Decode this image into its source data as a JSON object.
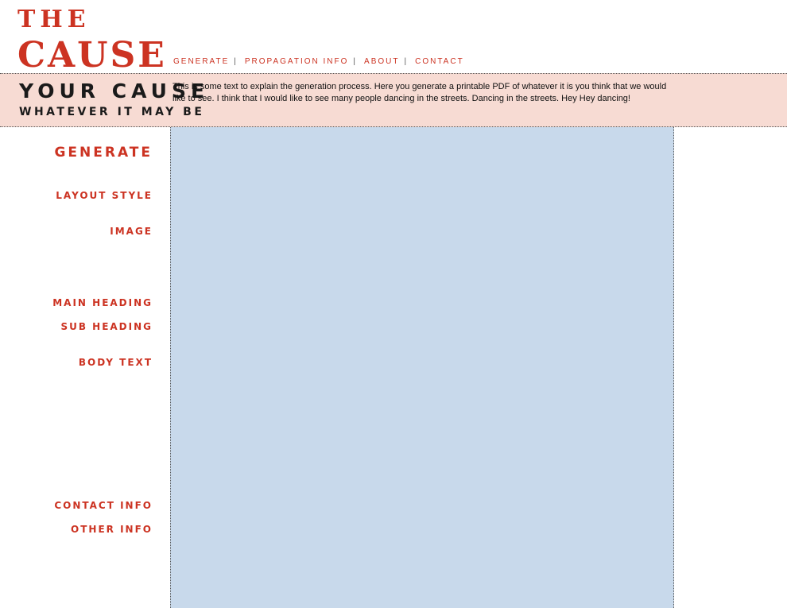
{
  "logo": {
    "line1": "THE",
    "line2": "CAUSE"
  },
  "nav": [
    {
      "label": "GENERATE"
    },
    {
      "label": "PROPAGATION INFO"
    },
    {
      "label": "ABOUT"
    },
    {
      "label": "CONTACT"
    }
  ],
  "nav_separator": "|",
  "band": {
    "title": "YOUR CAUSE",
    "subtitle": "WHATEVER IT MAY BE",
    "text": "This is some text to explain the generation process.  Here you generate a printable PDF of whatever it is you think that we would like to see.  I think that I would like to see many people dancing in the streets.  Dancing in the streets.  Hey Hey dancing!"
  },
  "sidebar": {
    "heading": "GENERATE",
    "items": [
      {
        "label": "LAYOUT STYLE"
      },
      {
        "label": "IMAGE"
      },
      {
        "label": "MAIN HEADING"
      },
      {
        "label": "SUB HEADING"
      },
      {
        "label": "BODY TEXT"
      },
      {
        "label": "CONTACT INFO"
      },
      {
        "label": "OTHER INFO"
      }
    ]
  },
  "colors": {
    "accent": "#cc3322",
    "band_bg": "#f7dbd3",
    "content_bg": "#c8d9eb"
  }
}
